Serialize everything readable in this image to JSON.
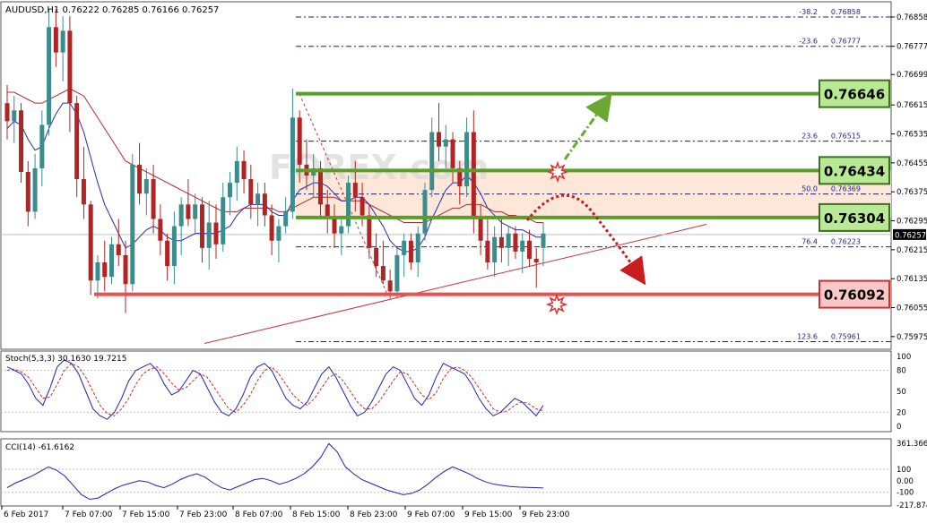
{
  "symbol_header": "AUDUSD,H1  0.76222 0.76285 0.76166 0.76257",
  "watermark": "FOREX.com",
  "colors": {
    "bull": "#3c8c8c",
    "bear": "#b22323",
    "ma_fast": "#2828b4",
    "ma_slow": "#b42828",
    "support_green": "#5a9e2a",
    "label_green_fill": "#b8e994",
    "resistance_red": "#e85050",
    "label_red_fill": "#f8c8c8",
    "zone_fill": "#fbe3d2",
    "fib_line": "#1e1e78",
    "stoch_main": "#2020c0",
    "stoch_signal": "#e02020",
    "cci_line": "#2020c0"
  },
  "chart_data": [
    {
      "type": "candlestick",
      "title": "AUDUSD,H1  0.76222 0.76285 0.76166 0.76257",
      "y_ticks": [
        "0.76858",
        "0.76777",
        "0.76699",
        "0.76615",
        "0.76535",
        "0.76455",
        "0.76375",
        "0.76295",
        "0.76215",
        "0.76135",
        "0.76055",
        "0.75975"
      ],
      "ylim": [
        0.7594,
        0.769
      ],
      "current_price": "0.76257",
      "x_labels": [
        "6 Feb 2017",
        "7 Feb 07:00",
        "7 Feb 15:00",
        "7 Feb 23:00",
        "8 Feb 07:00",
        "8 Feb 15:00",
        "8 Feb 23:00",
        "9 Feb 07:00",
        "9 Feb 15:00",
        "9 Feb 23:00"
      ],
      "candles": [
        {
          "o": 0.7662,
          "h": 0.7667,
          "l": 0.7652,
          "c": 0.7657
        },
        {
          "o": 0.7657,
          "h": 0.7664,
          "l": 0.7651,
          "c": 0.766
        },
        {
          "o": 0.766,
          "h": 0.7662,
          "l": 0.764,
          "c": 0.7643
        },
        {
          "o": 0.7643,
          "h": 0.7646,
          "l": 0.7628,
          "c": 0.7632
        },
        {
          "o": 0.7632,
          "h": 0.7648,
          "l": 0.763,
          "c": 0.7644
        },
        {
          "o": 0.7644,
          "h": 0.766,
          "l": 0.7639,
          "c": 0.7656
        },
        {
          "o": 0.7656,
          "h": 0.7688,
          "l": 0.7653,
          "c": 0.7683
        },
        {
          "o": 0.7683,
          "h": 0.7688,
          "l": 0.7672,
          "c": 0.7676
        },
        {
          "o": 0.7676,
          "h": 0.7686,
          "l": 0.7668,
          "c": 0.7682
        },
        {
          "o": 0.7682,
          "h": 0.7686,
          "l": 0.7654,
          "c": 0.7662
        },
        {
          "o": 0.7662,
          "h": 0.7664,
          "l": 0.7636,
          "c": 0.7641
        },
        {
          "o": 0.7641,
          "h": 0.765,
          "l": 0.763,
          "c": 0.7634
        },
        {
          "o": 0.7634,
          "h": 0.7635,
          "l": 0.7609,
          "c": 0.7613
        },
        {
          "o": 0.7613,
          "h": 0.762,
          "l": 0.7608,
          "c": 0.7618
        },
        {
          "o": 0.7618,
          "h": 0.7624,
          "l": 0.761,
          "c": 0.7614
        },
        {
          "o": 0.7614,
          "h": 0.7625,
          "l": 0.7612,
          "c": 0.7623
        },
        {
          "o": 0.7623,
          "h": 0.763,
          "l": 0.7617,
          "c": 0.762
        },
        {
          "o": 0.762,
          "h": 0.7624,
          "l": 0.7604,
          "c": 0.7612
        },
        {
          "o": 0.7612,
          "h": 0.7648,
          "l": 0.761,
          "c": 0.7645
        },
        {
          "o": 0.7645,
          "h": 0.7651,
          "l": 0.7634,
          "c": 0.7637
        },
        {
          "o": 0.7637,
          "h": 0.7644,
          "l": 0.7631,
          "c": 0.7641
        },
        {
          "o": 0.7641,
          "h": 0.7645,
          "l": 0.7626,
          "c": 0.763
        },
        {
          "o": 0.763,
          "h": 0.7634,
          "l": 0.762,
          "c": 0.7624
        },
        {
          "o": 0.7624,
          "h": 0.7626,
          "l": 0.7613,
          "c": 0.7617
        },
        {
          "o": 0.7617,
          "h": 0.7632,
          "l": 0.7612,
          "c": 0.7628
        },
        {
          "o": 0.7628,
          "h": 0.7636,
          "l": 0.762,
          "c": 0.7634
        },
        {
          "o": 0.7634,
          "h": 0.7641,
          "l": 0.7628,
          "c": 0.763
        },
        {
          "o": 0.763,
          "h": 0.7637,
          "l": 0.7626,
          "c": 0.7634
        },
        {
          "o": 0.7634,
          "h": 0.7636,
          "l": 0.7618,
          "c": 0.7622
        },
        {
          "o": 0.7622,
          "h": 0.7635,
          "l": 0.7616,
          "c": 0.7629
        },
        {
          "o": 0.7629,
          "h": 0.7634,
          "l": 0.7619,
          "c": 0.7623
        },
        {
          "o": 0.7623,
          "h": 0.764,
          "l": 0.7621,
          "c": 0.7636
        },
        {
          "o": 0.7636,
          "h": 0.7643,
          "l": 0.7631,
          "c": 0.764
        },
        {
          "o": 0.764,
          "h": 0.765,
          "l": 0.7635,
          "c": 0.7646
        },
        {
          "o": 0.7646,
          "h": 0.7649,
          "l": 0.7637,
          "c": 0.7641
        },
        {
          "o": 0.7641,
          "h": 0.7645,
          "l": 0.763,
          "c": 0.7634
        },
        {
          "o": 0.7634,
          "h": 0.764,
          "l": 0.7628,
          "c": 0.7637
        },
        {
          "o": 0.7637,
          "h": 0.764,
          "l": 0.7628,
          "c": 0.7631
        },
        {
          "o": 0.7631,
          "h": 0.7634,
          "l": 0.762,
          "c": 0.7624
        },
        {
          "o": 0.7624,
          "h": 0.763,
          "l": 0.7618,
          "c": 0.7628
        },
        {
          "o": 0.7628,
          "h": 0.7636,
          "l": 0.7626,
          "c": 0.7632
        },
        {
          "o": 0.7632,
          "h": 0.7666,
          "l": 0.763,
          "c": 0.7658
        },
        {
          "o": 0.7658,
          "h": 0.766,
          "l": 0.764,
          "c": 0.7645
        },
        {
          "o": 0.7645,
          "h": 0.7652,
          "l": 0.7638,
          "c": 0.7642
        },
        {
          "o": 0.7642,
          "h": 0.7648,
          "l": 0.7636,
          "c": 0.7644
        },
        {
          "o": 0.7644,
          "h": 0.7646,
          "l": 0.763,
          "c": 0.7634
        },
        {
          "o": 0.7634,
          "h": 0.7638,
          "l": 0.7626,
          "c": 0.763
        },
        {
          "o": 0.763,
          "h": 0.7634,
          "l": 0.7622,
          "c": 0.7626
        },
        {
          "o": 0.7626,
          "h": 0.763,
          "l": 0.762,
          "c": 0.7628
        },
        {
          "o": 0.7628,
          "h": 0.7642,
          "l": 0.7626,
          "c": 0.764
        },
        {
          "o": 0.764,
          "h": 0.7646,
          "l": 0.7632,
          "c": 0.7636
        },
        {
          "o": 0.7636,
          "h": 0.764,
          "l": 0.7628,
          "c": 0.7631
        },
        {
          "o": 0.7631,
          "h": 0.7634,
          "l": 0.7619,
          "c": 0.7622
        },
        {
          "o": 0.7622,
          "h": 0.7626,
          "l": 0.7614,
          "c": 0.7617
        },
        {
          "o": 0.7617,
          "h": 0.7624,
          "l": 0.7612,
          "c": 0.7613
        },
        {
          "o": 0.7613,
          "h": 0.7616,
          "l": 0.7608,
          "c": 0.761
        },
        {
          "o": 0.761,
          "h": 0.7622,
          "l": 0.7608,
          "c": 0.762
        },
        {
          "o": 0.762,
          "h": 0.7626,
          "l": 0.7614,
          "c": 0.7624
        },
        {
          "o": 0.7624,
          "h": 0.7626,
          "l": 0.7616,
          "c": 0.7618
        },
        {
          "o": 0.7618,
          "h": 0.7628,
          "l": 0.7614,
          "c": 0.7626
        },
        {
          "o": 0.7626,
          "h": 0.764,
          "l": 0.7624,
          "c": 0.7638
        },
        {
          "o": 0.7638,
          "h": 0.7658,
          "l": 0.7636,
          "c": 0.7654
        },
        {
          "o": 0.7654,
          "h": 0.7662,
          "l": 0.7646,
          "c": 0.765
        },
        {
          "o": 0.765,
          "h": 0.7656,
          "l": 0.7644,
          "c": 0.7652
        },
        {
          "o": 0.7652,
          "h": 0.7654,
          "l": 0.764,
          "c": 0.7644
        },
        {
          "o": 0.7644,
          "h": 0.7646,
          "l": 0.7634,
          "c": 0.7639
        },
        {
          "o": 0.7639,
          "h": 0.7658,
          "l": 0.7636,
          "c": 0.7654
        },
        {
          "o": 0.7654,
          "h": 0.766,
          "l": 0.7626,
          "c": 0.763
        },
        {
          "o": 0.763,
          "h": 0.7634,
          "l": 0.762,
          "c": 0.7624
        },
        {
          "o": 0.7624,
          "h": 0.763,
          "l": 0.7616,
          "c": 0.7618
        },
        {
          "o": 0.7618,
          "h": 0.7628,
          "l": 0.7614,
          "c": 0.7625
        },
        {
          "o": 0.7625,
          "h": 0.763,
          "l": 0.7618,
          "c": 0.7622
        },
        {
          "o": 0.7622,
          "h": 0.7628,
          "l": 0.7617,
          "c": 0.7626
        },
        {
          "o": 0.7626,
          "h": 0.7628,
          "l": 0.7619,
          "c": 0.7621
        },
        {
          "o": 0.7621,
          "h": 0.7626,
          "l": 0.7615,
          "c": 0.7624
        },
        {
          "o": 0.7624,
          "h": 0.7627,
          "l": 0.7617,
          "c": 0.7619
        },
        {
          "o": 0.7619,
          "h": 0.7622,
          "l": 0.7611,
          "c": 0.7618
        },
        {
          "o": 0.7622,
          "h": 0.7629,
          "l": 0.7617,
          "c": 0.7626
        }
      ],
      "ma_fast": [
        0.7655,
        0.7657,
        0.7656,
        0.7652,
        0.7649,
        0.765,
        0.7655,
        0.7659,
        0.7662,
        0.7662,
        0.7659,
        0.7654,
        0.7647,
        0.764,
        0.7634,
        0.763,
        0.7626,
        0.7622,
        0.7623,
        0.7625,
        0.7627,
        0.7628,
        0.7627,
        0.7625,
        0.7624,
        0.7624,
        0.7625,
        0.7626,
        0.7626,
        0.7626,
        0.7626,
        0.7627,
        0.7628,
        0.7631,
        0.7633,
        0.7634,
        0.7634,
        0.7634,
        0.7632,
        0.7631,
        0.7631,
        0.7635,
        0.7638,
        0.7639,
        0.764,
        0.764,
        0.7639,
        0.7637,
        0.7635,
        0.7635,
        0.7636,
        0.7636,
        0.7634,
        0.7631,
        0.7628,
        0.7624,
        0.7622,
        0.7621,
        0.7621,
        0.7622,
        0.7625,
        0.763,
        0.7634,
        0.7638,
        0.764,
        0.764,
        0.7642,
        0.764,
        0.7637,
        0.7633,
        0.7631,
        0.7629,
        0.7628,
        0.7627,
        0.7627,
        0.7626,
        0.7625,
        0.7625
      ],
      "ma_slow": [
        0.7665,
        0.7665,
        0.7664,
        0.7663,
        0.7662,
        0.7662,
        0.7663,
        0.7664,
        0.7665,
        0.7666,
        0.7665,
        0.7664,
        0.7661,
        0.7658,
        0.7655,
        0.7652,
        0.7649,
        0.7646,
        0.7645,
        0.7644,
        0.7643,
        0.7642,
        0.7641,
        0.764,
        0.7639,
        0.7638,
        0.7637,
        0.7636,
        0.7635,
        0.7634,
        0.7633,
        0.7632,
        0.7632,
        0.7632,
        0.7633,
        0.7633,
        0.7633,
        0.7633,
        0.7633,
        0.7632,
        0.7632,
        0.7633,
        0.7634,
        0.7635,
        0.7636,
        0.7636,
        0.7636,
        0.7636,
        0.7635,
        0.7635,
        0.7635,
        0.7635,
        0.7634,
        0.7633,
        0.7632,
        0.7631,
        0.763,
        0.7629,
        0.7629,
        0.7629,
        0.7629,
        0.763,
        0.7631,
        0.7632,
        0.7633,
        0.7633,
        0.7634,
        0.7634,
        0.7634,
        0.7633,
        0.7632,
        0.7632,
        0.7631,
        0.7631,
        0.763,
        0.763,
        0.7629,
        0.7629
      ],
      "fib_levels": [
        {
          "label": "-38.2",
          "price": "0.76858",
          "value": 0.76858
        },
        {
          "label": "-23.6",
          "price": "0.76777",
          "value": 0.76777
        },
        {
          "label": "23.6",
          "price": "0.76515",
          "value": 0.76515
        },
        {
          "label": "50.0",
          "price": "0.76369",
          "value": 0.76369
        },
        {
          "label": "76.4",
          "price": "0.76223",
          "value": 0.76223
        },
        {
          "label": "123.6",
          "price": "0.75961",
          "value": 0.75961
        }
      ],
      "levels": [
        {
          "name": "resistance-1",
          "label": "0.76646",
          "value": 0.76646,
          "kind": "green"
        },
        {
          "name": "resistance-2",
          "label": "0.76434",
          "value": 0.76434,
          "kind": "green"
        },
        {
          "name": "support-1",
          "label": "0.76304",
          "value": 0.76304,
          "kind": "green"
        },
        {
          "name": "support-2",
          "label": "0.76092",
          "value": 0.76092,
          "kind": "red"
        }
      ],
      "zone": {
        "from": 0.76304,
        "to": 0.76434
      }
    },
    {
      "type": "line",
      "title": "Stoch(5,3,3) 30.1630 19.7215",
      "ylim": [
        0,
        100
      ],
      "y_ticks": [
        "100",
        "80",
        "50",
        "20",
        "0"
      ],
      "series": [
        {
          "name": "main",
          "values": [
            85,
            80,
            75,
            60,
            40,
            30,
            55,
            85,
            95,
            90,
            75,
            50,
            25,
            15,
            10,
            20,
            40,
            65,
            80,
            85,
            90,
            80,
            60,
            45,
            50,
            65,
            80,
            75,
            55,
            35,
            20,
            15,
            25,
            45,
            70,
            85,
            90,
            80,
            60,
            40,
            30,
            25,
            35,
            55,
            75,
            85,
            70,
            50,
            30,
            15,
            20,
            35,
            55,
            75,
            85,
            80,
            60,
            40,
            30,
            45,
            70,
            90,
            85,
            80,
            75,
            60,
            40,
            25,
            15,
            20,
            30,
            40,
            35,
            25,
            15,
            30
          ]
        },
        {
          "name": "signal",
          "values": [
            80,
            82,
            78,
            70,
            55,
            40,
            42,
            60,
            80,
            90,
            85,
            70,
            50,
            30,
            18,
            15,
            25,
            40,
            60,
            75,
            82,
            85,
            75,
            62,
            52,
            55,
            65,
            75,
            70,
            55,
            40,
            25,
            20,
            30,
            45,
            65,
            80,
            85,
            75,
            60,
            45,
            35,
            30,
            40,
            55,
            70,
            75,
            65,
            50,
            35,
            25,
            25,
            35,
            50,
            65,
            78,
            75,
            60,
            45,
            38,
            48,
            68,
            82,
            85,
            80,
            70,
            55,
            40,
            25,
            20,
            22,
            30,
            35,
            32,
            25,
            22
          ]
        }
      ]
    },
    {
      "type": "line",
      "title": "CCI(14) -61.6162",
      "ylim": [
        -217.8747,
        361.3667
      ],
      "y_ticks": [
        "361.3667",
        "100",
        "0.00",
        "-100",
        "-217.8747"
      ],
      "series": [
        {
          "name": "CCI",
          "values": [
            -60,
            -20,
            10,
            40,
            80,
            120,
            90,
            40,
            -40,
            -120,
            -160,
            -150,
            -110,
            -70,
            -40,
            -20,
            0,
            -10,
            -40,
            -60,
            -30,
            10,
            40,
            60,
            30,
            -20,
            -60,
            -80,
            -50,
            -20,
            10,
            20,
            0,
            -30,
            -10,
            20,
            60,
            120,
            200,
            320,
            250,
            120,
            60,
            10,
            -20,
            -50,
            -80,
            -100,
            -120,
            -110,
            -80,
            -30,
            30,
            80,
            120,
            90,
            60,
            20,
            -10,
            -30,
            -40,
            -50,
            -55,
            -58,
            -60,
            -62
          ]
        }
      ]
    }
  ]
}
